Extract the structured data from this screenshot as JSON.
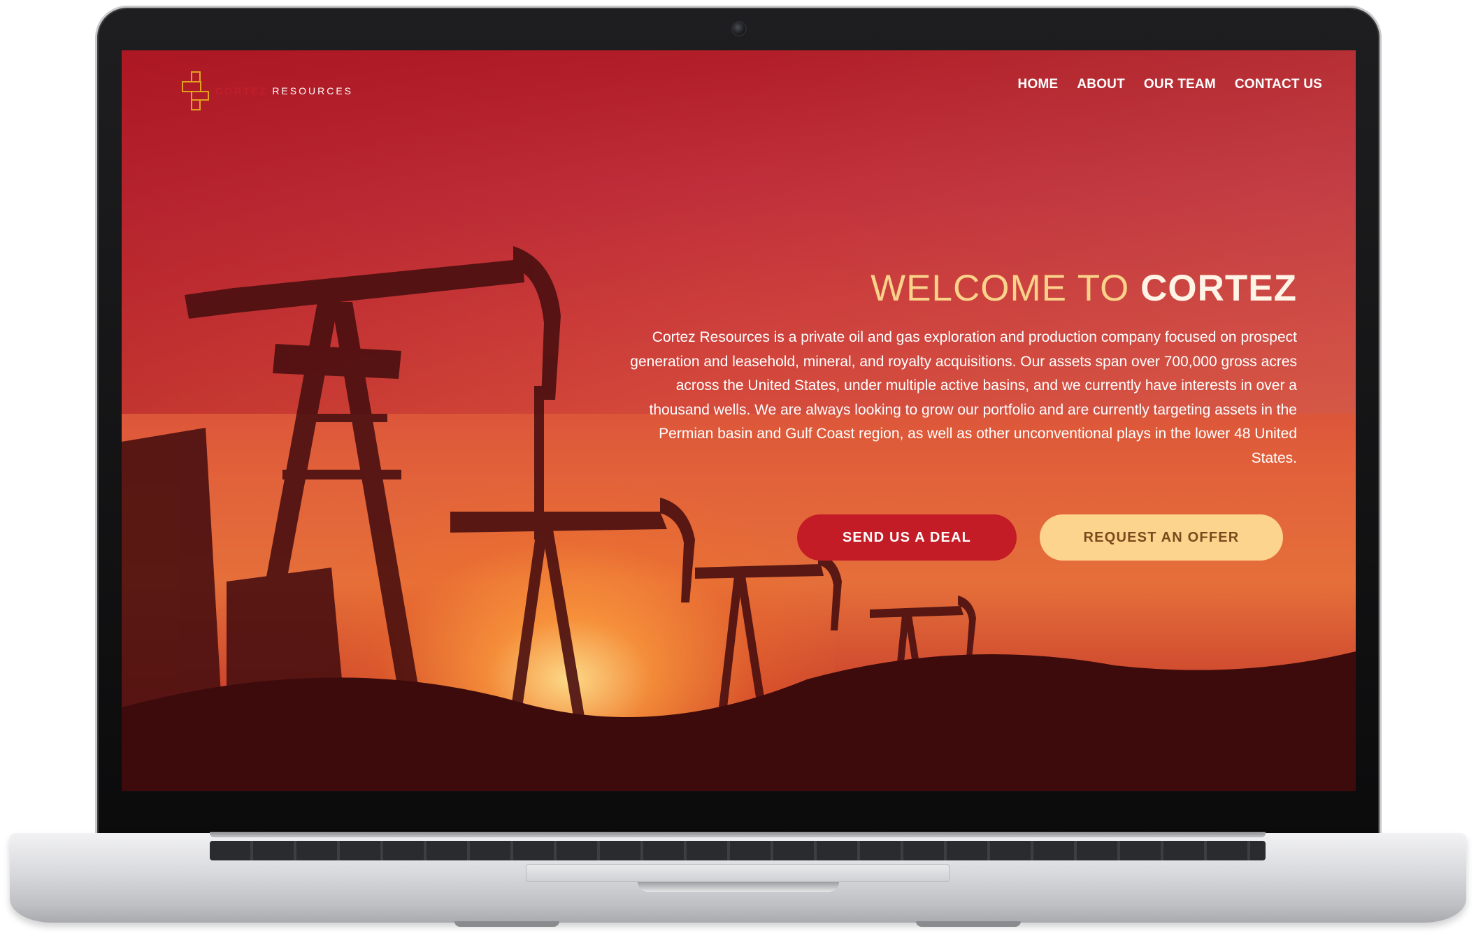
{
  "logo": {
    "word1": "CORTEZ",
    "word2": "RESOURCES"
  },
  "nav": {
    "items": [
      {
        "label": "HOME"
      },
      {
        "label": "ABOUT"
      },
      {
        "label": "OUR TEAM"
      },
      {
        "label": "CONTACT US"
      }
    ]
  },
  "hero": {
    "title_light": "WELCOME TO",
    "title_bold": "CORTEZ",
    "description": "Cortez Resources is a private oil and gas exploration and production company focused on prospect generation and leasehold, mineral, and royalty acquisitions. Our assets span over 700,000 gross acres across the United States, under multiple active basins, and we currently have interests in over a thousand wells. We are always looking to grow our portfolio and are currently targeting assets in the Permian basin and Gulf Coast region, as well as other unconventional plays in the lower 48 United States.",
    "primary_button": "SEND US A DEAL",
    "secondary_button": "REQUEST AN OFFER"
  },
  "colors": {
    "brand_red": "#c41c26",
    "accent_gold": "#fdd48d",
    "title_gold": "#fad28a"
  },
  "icons": {
    "logo_mark": "cortez-logo-icon",
    "camera": "webcam-icon"
  }
}
